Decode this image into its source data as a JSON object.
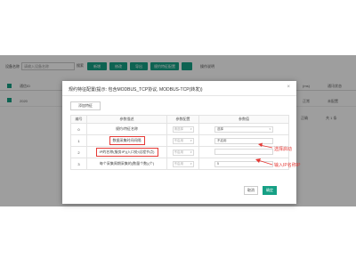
{
  "background": {
    "toolbar": {
      "label": "设备名称",
      "input_placeholder": "请输入设备名称",
      "search_label": "搜索",
      "buttons": [
        {
          "label": "新增",
          "color": "#16a085"
        },
        {
          "label": "修改",
          "color": "#16a085"
        },
        {
          "label": "导出",
          "color": "#16a085"
        },
        {
          "label": "规约特征配置",
          "color": "#16a085"
        },
        {
          "label": "",
          "color": "#16a085"
        }
      ],
      "help_label": "操作说明"
    },
    "header": {
      "col1": "通信ID",
      "col2": "(ms)",
      "col3": "通讯状态"
    },
    "row": {
      "id": "2020",
      "a": "正常",
      "b": "未配置"
    },
    "pager": {
      "left": "正确",
      "right": "共 1 条"
    }
  },
  "modal": {
    "title": "规约特征配置(提示: 包含MODBUS_TCP协议, MODBUS-TCP(转发))",
    "close_icon": "×",
    "add_button": "添加特征",
    "columns": [
      "编号",
      "参数描述",
      "参数配置",
      "参数值"
    ],
    "rows": [
      {
        "no": "0",
        "desc": "规约/特征名称",
        "select": "请选择",
        "value": "选择",
        "value_is_select": true,
        "highlight": false
      },
      {
        "no": "1",
        "desc": "数据采集时间间隔",
        "select": "不启用",
        "value": "不启用",
        "value_is_select": false,
        "highlight": true
      },
      {
        "no": "2",
        "desc": "IP的名称(服务IP)(入口处/远程节点)",
        "select": "不启用",
        "value": "",
        "value_is_select": false,
        "highlight": true
      },
      {
        "no": "3",
        "desc": "每个采集周期采集的(数量个数)(个)",
        "select": "不启用",
        "value": "5",
        "value_is_select": false,
        "highlight": false
      }
    ],
    "cancel_button": "取消",
    "ok_button": "确定"
  },
  "annotations": {
    "top": "选择启动",
    "bottom": "输入IP名称IP"
  },
  "colors": {
    "accent": "#16a085",
    "annotation": "#e53935"
  }
}
